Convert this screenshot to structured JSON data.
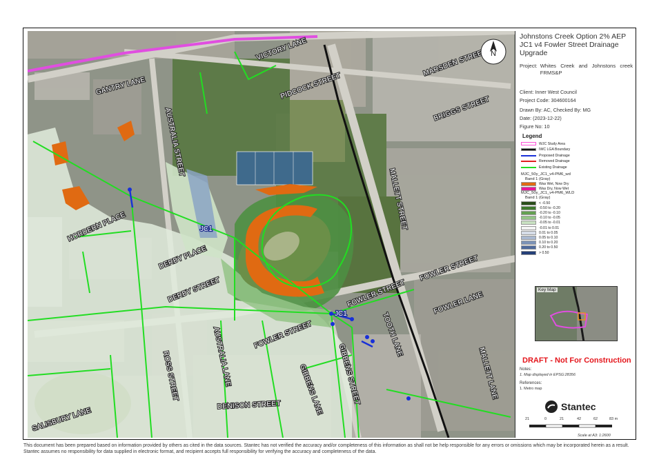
{
  "title": {
    "line1": "Johnstons Creek Option 2% AEP",
    "line2": "JC1 v4 Fowler Street Drainage",
    "line3": "Upgrade"
  },
  "meta": {
    "project_label": "Project:",
    "project_value": "Whites Creek and Johnstons creek FRMS&P",
    "client": "Client:  Inner West Council",
    "project_code": "Project Code:  304600164",
    "drawn_by": "Drawn By:  AC, Checked By: MG",
    "date": "Date:  (2023-12-22)",
    "figure": "Figure No:  10"
  },
  "legend": {
    "title": "Legend",
    "items": [
      {
        "label": "WJC Study Area",
        "color": "#ff4fd8"
      },
      {
        "label": "IWC LGA Boundary",
        "color": "#111111"
      },
      {
        "label": "Proposed Drainage",
        "color": "#1830d8"
      },
      {
        "label": "Removed Drainage",
        "color": "#e02020"
      },
      {
        "label": "Existing Drainage",
        "color": "#22dd22"
      }
    ],
    "group1_head": "MJC_50y_JC1_v4-PM6_wd",
    "group1_band": "Band 1 (Gray)",
    "group1_items": [
      {
        "label": "Was Wet, Now Dry",
        "color": "#e06a12"
      },
      {
        "label": "Was Dry, Now Wet",
        "color": "#e8179a"
      }
    ],
    "group2_head": "MJC_50y_JC1_v4-PM6_WLD",
    "group2_band": "Band 1 (Gray)",
    "group2_items": [
      {
        "label": "< -0.50",
        "color": "#2a4d1a"
      },
      {
        "label": "-0.50 to -0.20",
        "color": "#3f7a2e"
      },
      {
        "label": "-0.20 to -0.10",
        "color": "#63a051"
      },
      {
        "label": "-0.10 to -0.05",
        "color": "#94c487"
      },
      {
        "label": "-0.05 to -0.01",
        "color": "#c8e0c1"
      },
      {
        "label": "-0.01 to 0.01",
        "color": "#f4f4f4"
      },
      {
        "label": "0.01 to 0.05",
        "color": "#d6dde8"
      },
      {
        "label": "0.05 to 0.10",
        "color": "#a9b8d0"
      },
      {
        "label": "0.10 to 0.20",
        "color": "#7c93b8"
      },
      {
        "label": "0.20 to 0.50",
        "color": "#4f6a9c"
      },
      {
        "label": "> 0.50",
        "color": "#243f78"
      }
    ]
  },
  "key_map": {
    "label": "Key Map"
  },
  "draft": "DRAFT - Not For Construction",
  "notes": {
    "head": "Notes:",
    "line": "1. Map displayed in EPSG:28356"
  },
  "references": {
    "head": "References:",
    "line": "1. Metro map"
  },
  "logo": {
    "text": "Stantec"
  },
  "scale": {
    "ticks": [
      "21",
      "0",
      "21",
      "42",
      "62",
      "83 m"
    ],
    "caption": "Scale at A3: 1:2600"
  },
  "north": "N",
  "streets": {
    "victory": "VICTORY LANE",
    "marsden": "MARSDEN STREET",
    "gantry": "GANTRY LANE",
    "pidcock": "PIDCOCK STREET",
    "australia_n": "AUSTRALIA STREET",
    "briggs": "BRIGGS STREET",
    "hordern": "HORDERN PLACE",
    "mallett": "MALLETT STREET",
    "derby_place": "DERBY PLACE",
    "fowler_e": "FOWLER STREET",
    "derby_st": "DERBY STREET",
    "fowler_c": "FOWLER STREET",
    "fowler_lane": "FOWLER LANE",
    "fowler_w": "FOWLER STREET",
    "tooth": "TOOTH LANE",
    "australia_lane": "AUSTRALIA LANE",
    "ross": "ROSS STREET",
    "gibbens_st": "GIBBENS STREET",
    "mallett_lane": "MALLETT LANE",
    "gibbens_lane": "GIBBENS LANE",
    "denison": "DENISON STREET",
    "salisbury": "SALISBURY LANE"
  },
  "jc_labels": {
    "a": "JC1",
    "b": "JC1"
  },
  "disclaimer": "This document has been prepared based on information provided by others as cited in the data sources. Stantec has not verified the accuracy and/or completeness of this information as shall not be help responsible for any errors or omissions which may be incorporated herein as a result. Stantec assumes no responsibility for data supplied in electronic format, and recipient accepts full responsibility for verifying the accuracy and completeness of the data."
}
